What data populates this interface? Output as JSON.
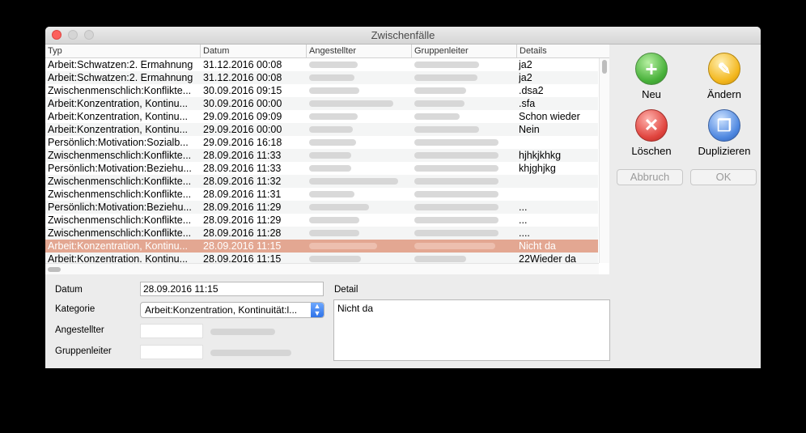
{
  "window": {
    "title": "Zwischenfälle"
  },
  "table": {
    "columns": [
      "Typ",
      "Datum",
      "Angestellter",
      "Gruppenleiter",
      "Details"
    ],
    "rows": [
      {
        "typ": "Arbeit:Schwatzen:2. Ermahnung",
        "datum": "31.12.2016  00:08",
        "details": "ja2"
      },
      {
        "typ": "Arbeit:Schwatzen:2. Ermahnung",
        "datum": "31.12.2016  00:08",
        "details": "ja2"
      },
      {
        "typ": "Zwischenmenschlich:Konflikte...",
        "datum": "30.09.2016  09:15",
        "details": ".dsa2"
      },
      {
        "typ": "Arbeit:Konzentration, Kontinu...",
        "datum": "30.09.2016  00:00",
        "details": ".sfa"
      },
      {
        "typ": "Arbeit:Konzentration, Kontinu...",
        "datum": "29.09.2016  09:09",
        "details": "Schon wieder"
      },
      {
        "typ": "Arbeit:Konzentration, Kontinu...",
        "datum": "29.09.2016  00:00",
        "details": "Nein"
      },
      {
        "typ": "Persönlich:Motivation:Sozialb...",
        "datum": "29.09.2016  16:18",
        "details": ""
      },
      {
        "typ": "Zwischenmenschlich:Konflikte...",
        "datum": "28.09.2016  11:33",
        "details": "hjhkjkhkg"
      },
      {
        "typ": "Persönlich:Motivation:Beziehu...",
        "datum": "28.09.2016  11:33",
        "details": "khjghjkg"
      },
      {
        "typ": "Zwischenmenschlich:Konflikte...",
        "datum": "28.09.2016  11:32",
        "details": ""
      },
      {
        "typ": "Zwischenmenschlich:Konflikte...",
        "datum": "28.09.2016  11:31",
        "details": ""
      },
      {
        "typ": "Persönlich:Motivation:Beziehu...",
        "datum": "28.09.2016  11:29",
        "details": "..."
      },
      {
        "typ": "Zwischenmenschlich:Konflikte...",
        "datum": "28.09.2016  11:29",
        "details": "..."
      },
      {
        "typ": "Zwischenmenschlich:Konflikte...",
        "datum": "28.09.2016  11:28",
        "details": "...."
      },
      {
        "typ": "Arbeit:Konzentration, Kontinu...",
        "datum": "28.09.2016  11:15",
        "details": "Nicht da"
      },
      {
        "typ": "Arbeit:Konzentration. Kontinu...",
        "datum": "28.09.2016  11:15",
        "details": "22Wieder da"
      }
    ],
    "selected_row_index": 14
  },
  "actions": {
    "neu": "Neu",
    "aendern": "Ändern",
    "loeschen": "Löschen",
    "duplizieren": "Duplizieren",
    "abbruch": "Abbruch",
    "ok": "OK"
  },
  "form": {
    "datum_label": "Datum",
    "datum_value": "28.09.2016  11:15",
    "kategorie_label": "Kategorie",
    "kategorie_value": "Arbeit:Konzentration, Kontinuität:l...",
    "angestellter_label": "Angestellter",
    "gruppenleiter_label": "Gruppenleiter",
    "detail_label": "Detail",
    "detail_value": "Nicht da"
  },
  "colors": {
    "selection": "#e3a792",
    "accent_select": "#2f72e8"
  },
  "icons": [
    "plus-icon",
    "pencil-icon",
    "x-icon",
    "duplicate-icon",
    "chevron-updown-icon"
  ]
}
